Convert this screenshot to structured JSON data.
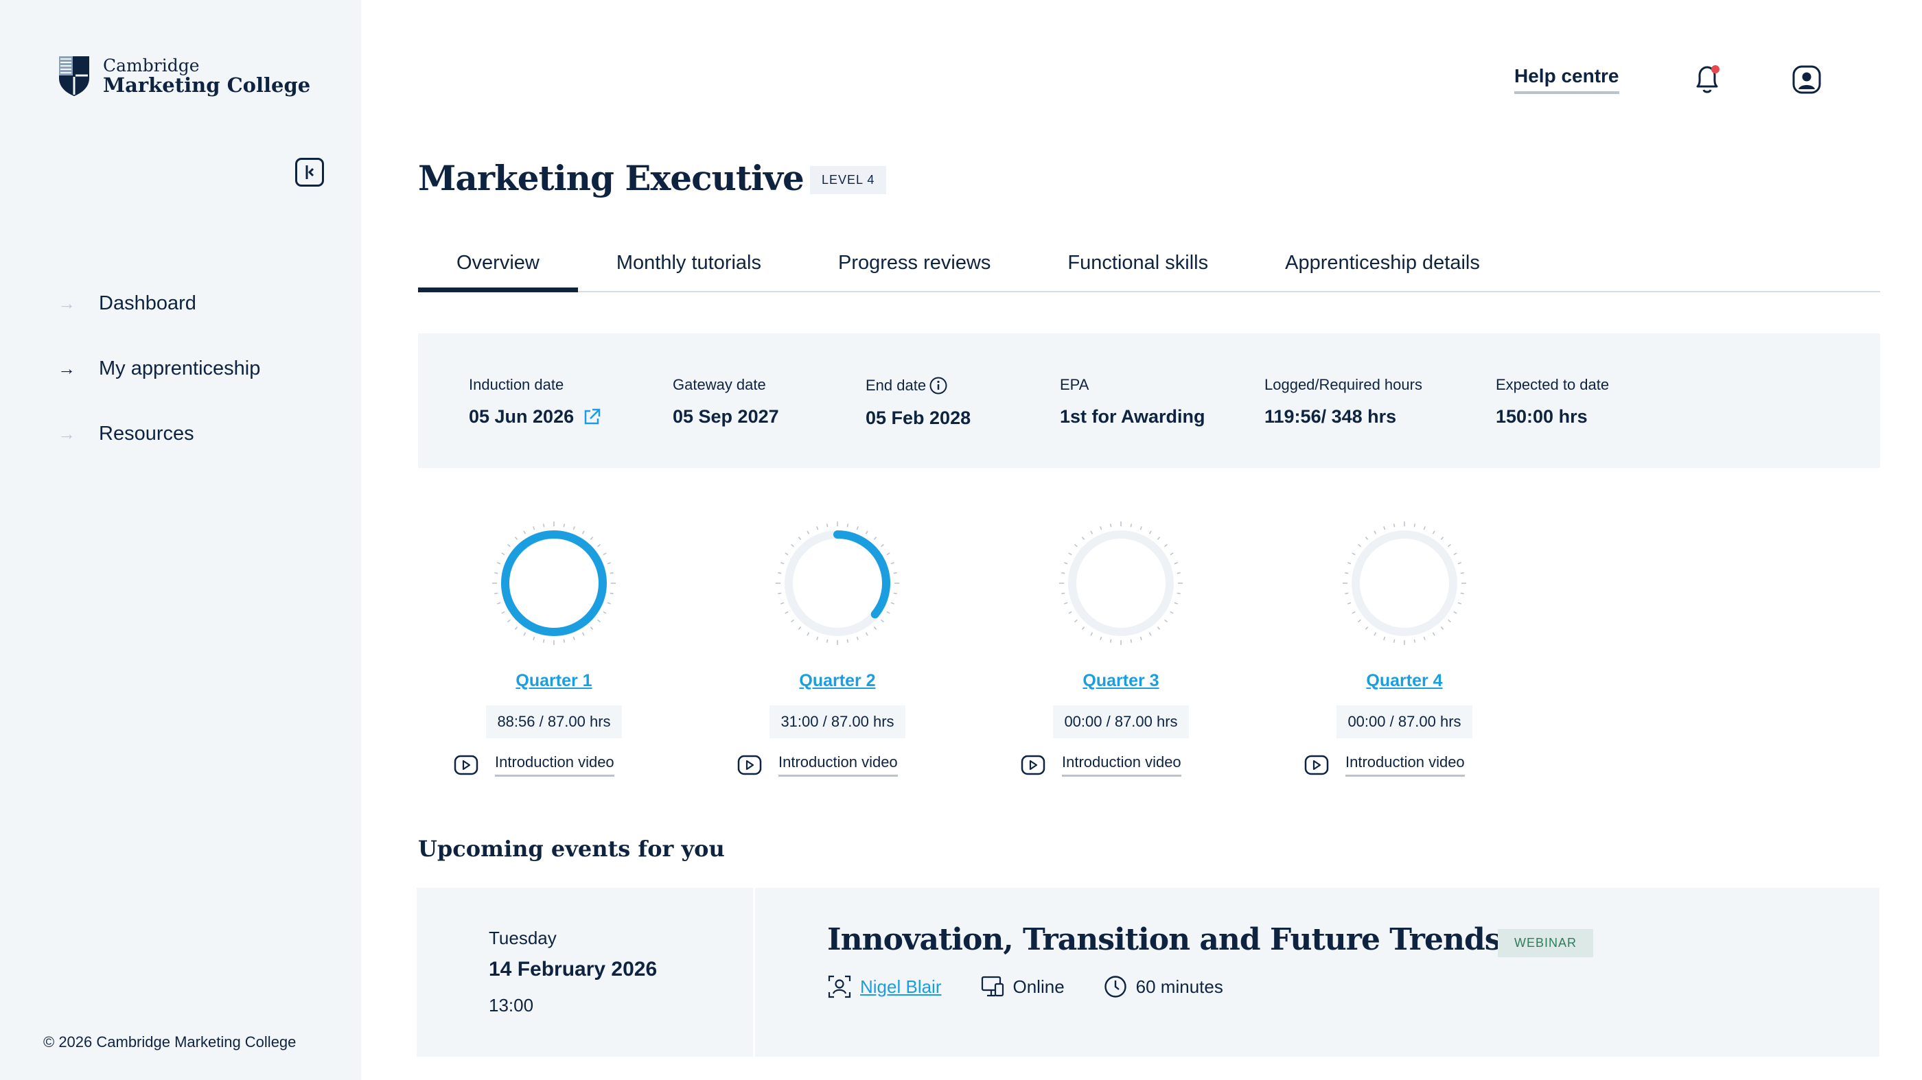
{
  "sidebar": {
    "logo_small": "Cambridge",
    "logo_big": "Marketing College",
    "collapse_icon": "collapse-sidebar-icon",
    "items": [
      {
        "label": "Dashboard",
        "active": false
      },
      {
        "label": "My apprenticeship",
        "active": true
      },
      {
        "label": "Resources",
        "active": false
      }
    ],
    "copyright": "© 2026 Cambridge Marketing College"
  },
  "header": {
    "help": "Help centre",
    "notification_dot_color": "#e5484d"
  },
  "page": {
    "title": "Marketing Executive",
    "level": "LEVEL 4"
  },
  "tabs": [
    "Overview",
    "Monthly tutorials",
    "Progress reviews",
    "Functional skills",
    "Apprenticeship details"
  ],
  "info": [
    {
      "label": "Induction date",
      "value": "05 Jun 2026"
    },
    {
      "label": "Gateway date",
      "value": "05 Sep 2027"
    },
    {
      "label": "End date",
      "value": "05 Feb 2028"
    },
    {
      "label": "EPA",
      "value": "1st for Awarding"
    },
    {
      "label": "Logged/Required hours",
      "value": "119:56/ 348 hrs"
    },
    {
      "label": "Expected to date",
      "value": "150:00 hrs"
    }
  ],
  "quarters": [
    {
      "label": "Quarter 1",
      "hours": "88:56 / 87.00 hrs",
      "progress": 1.0,
      "video": "Introduction video"
    },
    {
      "label": "Quarter 2",
      "hours": "31:00 / 87.00 hrs",
      "progress": 0.36,
      "video": "Introduction video"
    },
    {
      "label": "Quarter 3",
      "hours": "00:00 / 87.00 hrs",
      "progress": 0,
      "video": "Introduction video"
    },
    {
      "label": "Quarter 4",
      "hours": "00:00 / 87.00 hrs",
      "progress": 0,
      "video": "Introduction video"
    }
  ],
  "events": {
    "title": "Upcoming events for you",
    "event": {
      "day": "Tuesday",
      "date": "14 February 2026",
      "time": "13:00",
      "name": "Innovation, Transition and Future Trends",
      "badge": "WEBINAR",
      "host": "Nigel Blair",
      "mode": "Online",
      "duration": "60 minutes"
    }
  },
  "colors": {
    "navy": "#0d2340",
    "accent": "#1a9ee0",
    "panel": "#f3f6f9",
    "badge_bg": "#dde9e7",
    "badge_text": "#2c7e5a"
  }
}
